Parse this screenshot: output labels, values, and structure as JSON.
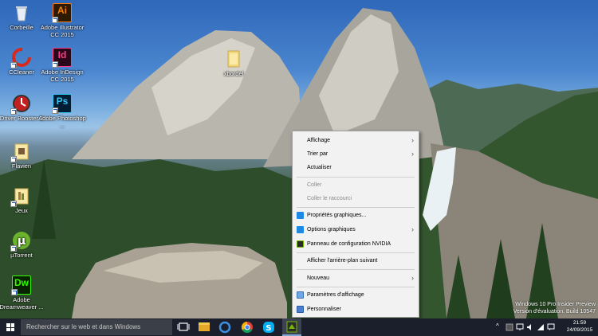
{
  "desktop_icons": [
    {
      "label": "Corbeille",
      "icon": "recycle-bin-icon"
    },
    {
      "label": "Adobe Illustrator CC 2015",
      "icon": "illustrator-icon",
      "glyph": "Ai",
      "color": "#ff7c00",
      "bg": "#2d1a00"
    },
    {
      "label": "CCleaner",
      "icon": "ccleaner-icon"
    },
    {
      "label": "Adobe InDesign CC 2015",
      "icon": "indesign-icon",
      "glyph": "Id",
      "color": "#ff3b8a",
      "bg": "#2a0719"
    },
    {
      "label": "Driver Booster 2",
      "icon": "driver-booster-icon"
    },
    {
      "label": "Adobe Photoshop ...",
      "icon": "photoshop-icon",
      "glyph": "Ps",
      "color": "#31c5f4",
      "bg": "#001d34"
    },
    {
      "label": "Flavien",
      "icon": "folder-icon"
    },
    {
      "label": "Jeux",
      "icon": "folder-icon"
    },
    {
      "label": "µTorrent",
      "icon": "utorrent-icon"
    },
    {
      "label": "Adobe Dreamweaver ...",
      "icon": "dreamweaver-icon",
      "glyph": "Dw",
      "color": "#35fa00",
      "bg": "#072401"
    },
    {
      "label": "xbordel",
      "icon": "folder-icon"
    }
  ],
  "context_menu": {
    "items": [
      {
        "label": "Affichage",
        "submenu": true,
        "enabled": true
      },
      {
        "label": "Trier par",
        "submenu": true,
        "enabled": true
      },
      {
        "label": "Actualiser",
        "submenu": false,
        "enabled": true
      },
      {
        "label": "Coller",
        "submenu": false,
        "enabled": false
      },
      {
        "label": "Coller le raccourci",
        "submenu": false,
        "enabled": false
      },
      {
        "label": "Propriétés graphiques...",
        "submenu": false,
        "enabled": true,
        "icon": "intel-graphics-icon"
      },
      {
        "label": "Options graphiques",
        "submenu": true,
        "enabled": true,
        "icon": "intel-graphics-icon"
      },
      {
        "label": "Panneau de configuration NVIDIA",
        "submenu": false,
        "enabled": true,
        "icon": "nvidia-icon"
      },
      {
        "label": "Afficher l'arrière-plan suivant",
        "submenu": false,
        "enabled": true
      },
      {
        "label": "Nouveau",
        "submenu": true,
        "enabled": true
      },
      {
        "label": "Paramètres d'affichage",
        "submenu": false,
        "enabled": true,
        "icon": "display-settings-icon"
      },
      {
        "label": "Personnaliser",
        "submenu": false,
        "enabled": true,
        "icon": "personalize-icon"
      }
    ]
  },
  "taskbar": {
    "search_placeholder": "Rechercher sur le web et dans Windows",
    "clock_time": "21:59",
    "clock_date": "24/09/2015"
  },
  "watermark": {
    "line1": "Windows 10 Pro Insider Preview",
    "line2": "Version d'évaluation. Build 10547"
  },
  "colors": {
    "taskbar": "#1a1f2b",
    "menu_bg": "#f2f2f2",
    "accent": "#7fa7d8"
  }
}
